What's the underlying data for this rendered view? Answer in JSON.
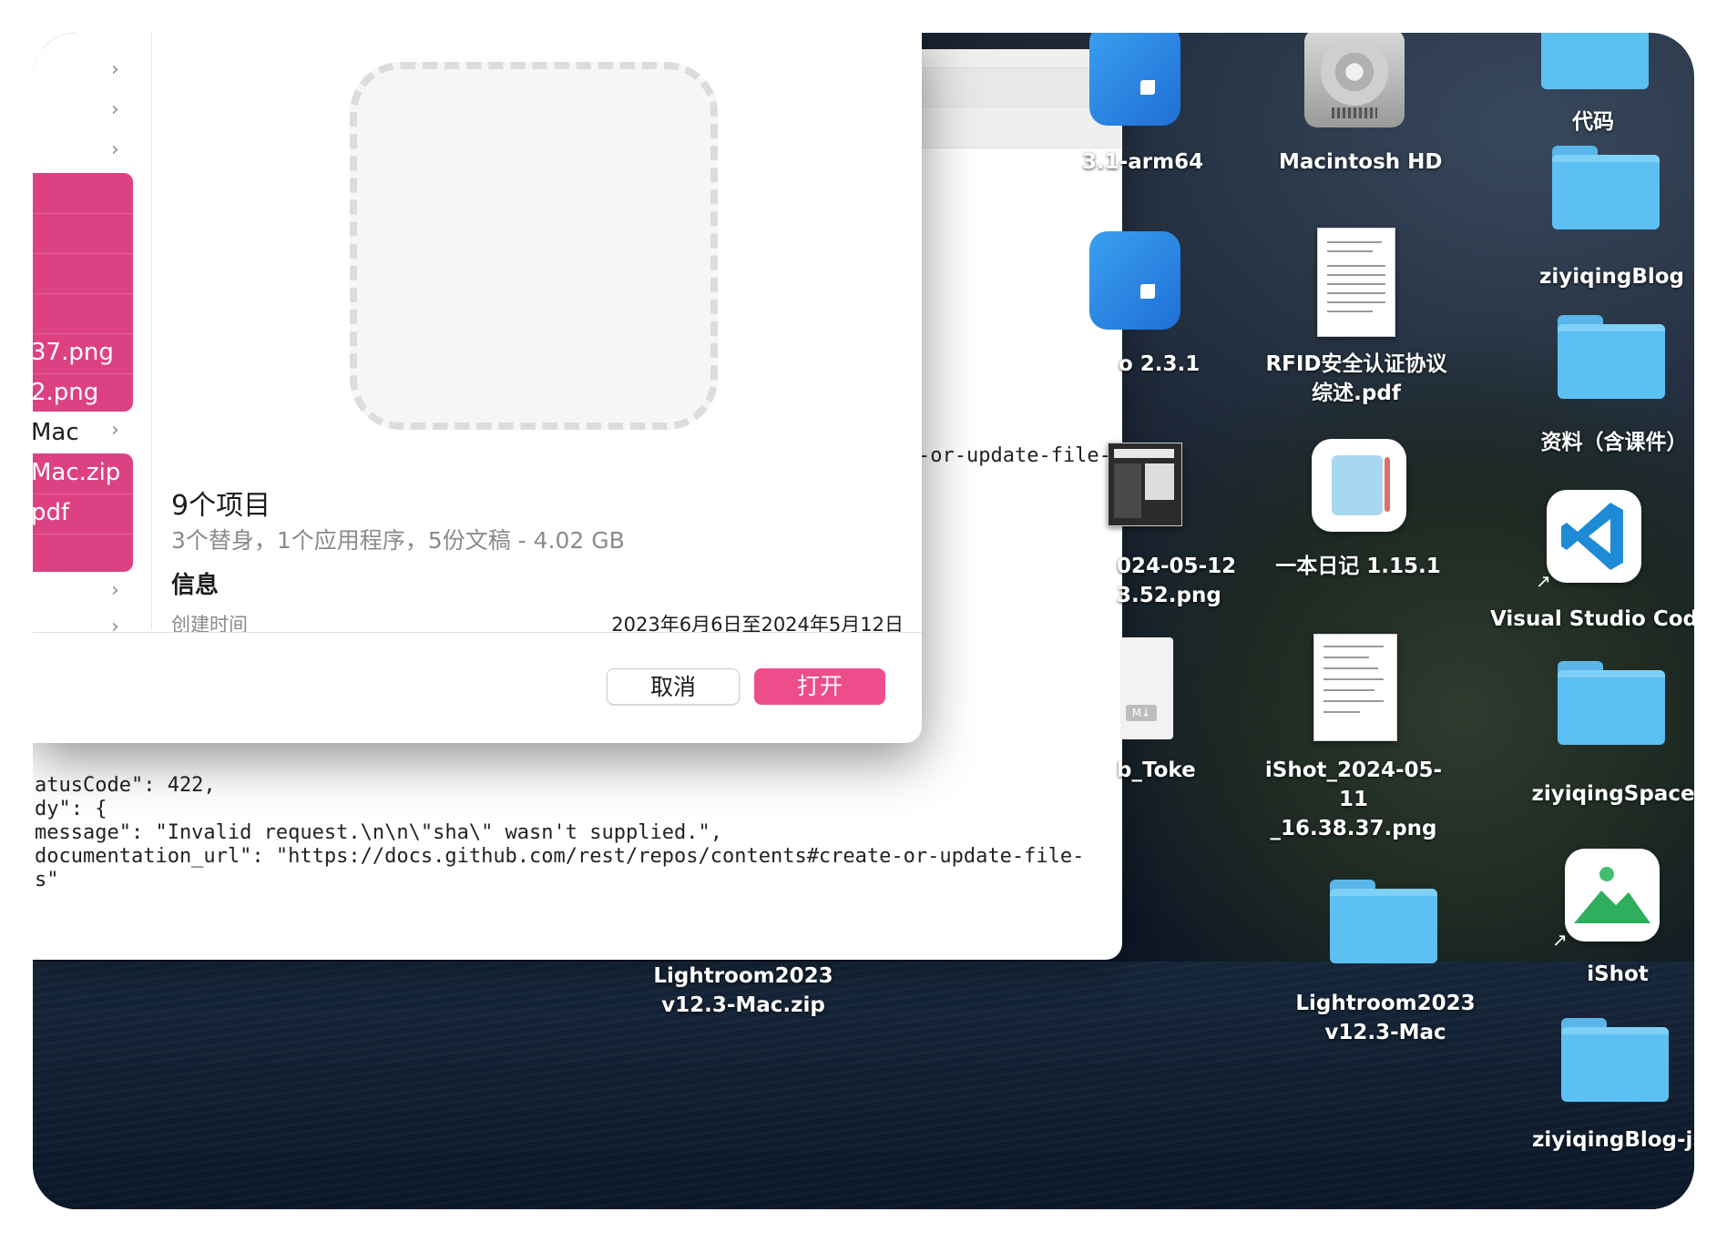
{
  "dialog": {
    "sidebar_items": [
      {
        "label": "",
        "type": "pink"
      },
      {
        "label": "",
        "type": "pink"
      },
      {
        "label": "",
        "type": "pink"
      },
      {
        "label": "37.png",
        "type": "pink"
      },
      {
        "label": "2.png",
        "type": "pink"
      },
      {
        "label": "Mac",
        "type": "plain"
      },
      {
        "label": "Mac.zip",
        "type": "pink"
      },
      {
        "label": "pdf",
        "type": "pink"
      }
    ],
    "sidebar_labels": {
      "png1": "37.png",
      "png2": "2.png",
      "mac": "Mac",
      "zip": "Mac.zip",
      "pdf": "pdf"
    },
    "item_count": "9个项目",
    "item_summary": "3个替身，1个应用程序，5份文稿 - 4.02 GB",
    "info_title": "信息",
    "created_label": "创建时间",
    "created_value": "2023年6月6日至2024年5月12日",
    "cancel_label": "取消",
    "open_label": "打开"
  },
  "terminal": {
    "line_top": "-or-update-file-",
    "lines": [
      "atusCode\": 422,",
      "dy\": {",
      "message\": \"Invalid request.\\n\\n\\\"sha\\\" wasn't supplied.\",",
      "documentation_url\": \"https://docs.github.com/rest/repos/contents#create-or-update-file-",
      "s\""
    ]
  },
  "desktop": {
    "icons": [
      {
        "label": "3.1-arm64",
        "icon": "app-icon"
      },
      {
        "label": "Macintosh HD",
        "icon": "hard-drive-icon"
      },
      {
        "label": "代码",
        "icon": "folder-icon"
      },
      {
        "label": "ziyiqingBlog",
        "icon": "folder-icon"
      },
      {
        "label": "o 2.3.1",
        "icon": "app-icon"
      },
      {
        "label": "RFID安全认证协议\n综述.pdf",
        "icon": "pdf-icon"
      },
      {
        "label": "资料（含课件）",
        "icon": "folder-icon"
      },
      {
        "label": "024-05-12\n3.52.png",
        "icon": "image-icon"
      },
      {
        "label": "一本日记 1.15.1",
        "icon": "diary-app-icon"
      },
      {
        "label": "Visual Studio Code",
        "icon": "vscode-icon"
      },
      {
        "label": "b_Toke",
        "icon": "markdown-file-icon"
      },
      {
        "label": "iShot_2024-05-11\n_16.38.37.png",
        "icon": "image-icon"
      },
      {
        "label": "ziyiqingSpace",
        "icon": "folder-icon"
      },
      {
        "label": "Lightroom2023\nv12.3-Mac.zip",
        "icon": "zip-icon"
      },
      {
        "label": "Lightroom2023\nv12.3-Mac",
        "icon": "folder-icon"
      },
      {
        "label": "iShot",
        "icon": "ishot-app-icon"
      },
      {
        "label": "ziyiqingBlog-js",
        "icon": "folder-icon"
      }
    ]
  }
}
